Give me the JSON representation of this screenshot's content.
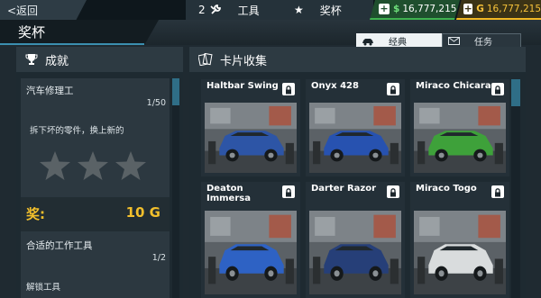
{
  "topbar": {
    "back_label": "<返回",
    "tools_count": "2",
    "tools_label": "工具",
    "trophy_label": "奖杯",
    "cash_symbol": "$",
    "cash_value": "16,777,215",
    "gold_symbol": "G",
    "gold_value": "16,777,215"
  },
  "page_title": "奖杯",
  "tabs": [
    {
      "label": "经典",
      "icon": "car-icon",
      "active": true
    },
    {
      "label": "任务",
      "icon": "envelope-icon",
      "active": false
    }
  ],
  "achievements": {
    "header": "成就",
    "items": [
      {
        "name": "汽车修理工",
        "progress": "1/50",
        "description": "拆下坏的零件，换上新的",
        "stars": 3,
        "reward_label": "奖:",
        "reward_value": "10 G"
      },
      {
        "name": "合适的工作工具",
        "progress": "1/2",
        "description": "解锁工具"
      }
    ]
  },
  "cards": {
    "header": "卡片收集",
    "items": [
      {
        "name": "Haltbar Swing",
        "car_color": "#2d55a6"
      },
      {
        "name": "Onyx 428",
        "car_color": "#2752b0"
      },
      {
        "name": "Miraco Chicara",
        "car_color": "#3ea13a"
      },
      {
        "name": "Deaton Immersa",
        "car_color": "#2e62c4"
      },
      {
        "name": "Darter Razor",
        "car_color": "#263f78"
      },
      {
        "name": "Miraco Togo",
        "car_color": "#d9dcdd"
      }
    ]
  },
  "colors": {
    "accent_blue": "#3b8fb0",
    "cash_green": "#3fb24f",
    "gold": "#f2b824"
  }
}
